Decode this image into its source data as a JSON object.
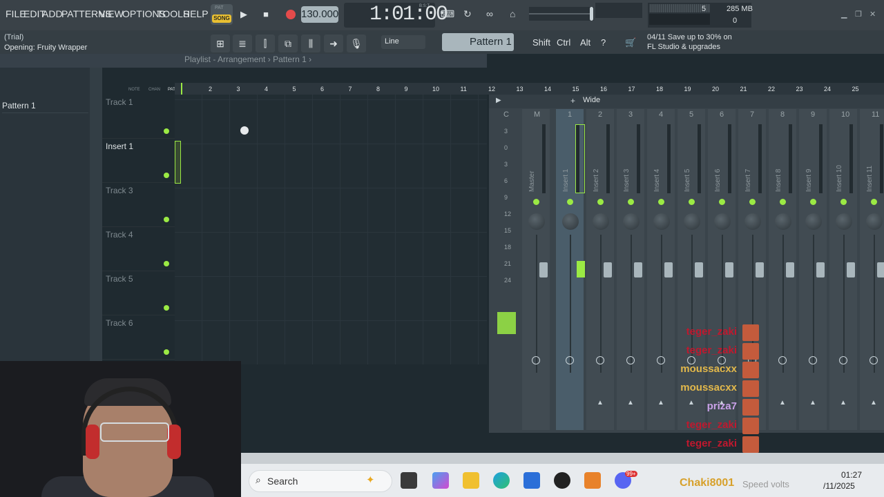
{
  "menu": [
    "FILE",
    "EDIT",
    "ADD",
    "PATTERNS",
    "VIEW",
    "OPTIONS",
    "TOOLS",
    "HELP"
  ],
  "transport": {
    "pat_label": "PAT",
    "song_label": "SONG",
    "tempo": "130.000",
    "time": "1:01:00",
    "time_unit": "B:S:T"
  },
  "monitor": {
    "cpu": "5",
    "ram": "285 MB",
    "poly": "0"
  },
  "hint": {
    "line1": "(Trial)",
    "line2": "Opening: Fruity Wrapper"
  },
  "toolbar": {
    "snap": "Line",
    "pattern": "Pattern 1",
    "keys": [
      "Shift",
      "Ctrl",
      "Alt"
    ]
  },
  "news": {
    "date": "04/11",
    "line1": "Save up to 30% on",
    "line2": "FL Studio & upgrades"
  },
  "playlist": {
    "title": "Playlist - Arrangement",
    "pattern_crumb": "Pattern 1",
    "picker_item": "Pattern 1",
    "tool_labels": [
      "NOTE",
      "CHAN",
      "PAT"
    ],
    "ruler": [
      "2",
      "3",
      "4",
      "5",
      "6",
      "7",
      "8",
      "9",
      "10",
      "11",
      "12",
      "13",
      "14",
      "15",
      "16",
      "17",
      "18",
      "19",
      "20",
      "21",
      "22",
      "23",
      "24",
      "25"
    ],
    "tracks": [
      "Track 1",
      "Insert 1",
      "Track 3",
      "Track 4",
      "Track 5",
      "Track 6"
    ]
  },
  "mixer": {
    "mode": "Wide",
    "headers": [
      "C",
      "M",
      "1",
      "2",
      "3",
      "4",
      "5",
      "6",
      "7",
      "8",
      "9",
      "10",
      "11"
    ],
    "names": [
      "Master",
      "Insert 1",
      "Insert 2",
      "Insert 3",
      "Insert 4",
      "Insert 5",
      "Insert 6",
      "Insert 7",
      "Insert 8",
      "Insert 9",
      "Insert 10",
      "Insert 11"
    ],
    "scale": [
      "3",
      "0",
      "3",
      "6",
      "9",
      "12",
      "15",
      "18",
      "21",
      "24"
    ]
  },
  "chat": [
    {
      "user": "teger_zaki",
      "color": "#c0182e"
    },
    {
      "user": "teger_zaki",
      "color": "#c0182e"
    },
    {
      "user": "moussacxx",
      "color": "#e2b84b"
    },
    {
      "user": "moussacxx",
      "color": "#e2b84b"
    },
    {
      "user": "priza7",
      "color": "#c9a1e8"
    },
    {
      "user": "teger_zaki",
      "color": "#c0182e"
    },
    {
      "user": "teger_zaki",
      "color": "#c0182e"
    },
    {
      "user": "teger_zaki",
      "color": "#c0182e"
    }
  ],
  "overlay": {
    "name": "Chaki8001",
    "speed": "Speed volts"
  },
  "taskbar": {
    "search": "Search",
    "time": "01:27",
    "date": "/11/2025",
    "badge": "99+"
  }
}
